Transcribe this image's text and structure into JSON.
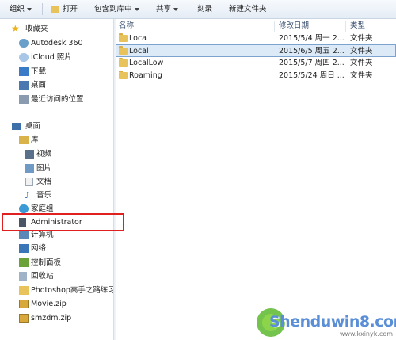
{
  "toolbar": {
    "organize": "组织",
    "open": "打开",
    "include_library": "包含到库中",
    "share": "共享",
    "burn": "刻录",
    "new_folder": "新建文件夹"
  },
  "nav": {
    "favorites": "收藏夹",
    "autodesk": "Autodesk 360",
    "icloud": "iCloud 照片",
    "downloads": "下载",
    "desktop": "桌面",
    "recent": "最近访问的位置",
    "desktop_root": "桌面",
    "library": "库",
    "video": "视频",
    "pictures": "图片",
    "documents": "文档",
    "music": "音乐",
    "homegroup": "家庭组",
    "admin": "Administrator",
    "computer": "计算机",
    "network": "网络",
    "control_panel": "控制面板",
    "recycle_bin": "回收站",
    "photoshop": "Photoshop高手之路练习",
    "movie_zip": "Movie.zip",
    "smzdm_zip": "smzdm.zip"
  },
  "columns": {
    "name": "名称",
    "date": "修改日期",
    "type": "类型"
  },
  "files": [
    {
      "name": "Loca",
      "date": "2015/5/4 周一 2...",
      "type": "文件夹"
    },
    {
      "name": "Local",
      "date": "2015/6/5 周五 2...",
      "type": "文件夹"
    },
    {
      "name": "LocalLow",
      "date": "2015/5/7 周四 2...",
      "type": "文件夹"
    },
    {
      "name": "Roaming",
      "date": "2015/5/24 周日 ...",
      "type": "文件夹"
    }
  ],
  "watermark": {
    "text": "Shenduwin8.com",
    "url": "www.kxinyk.com"
  }
}
